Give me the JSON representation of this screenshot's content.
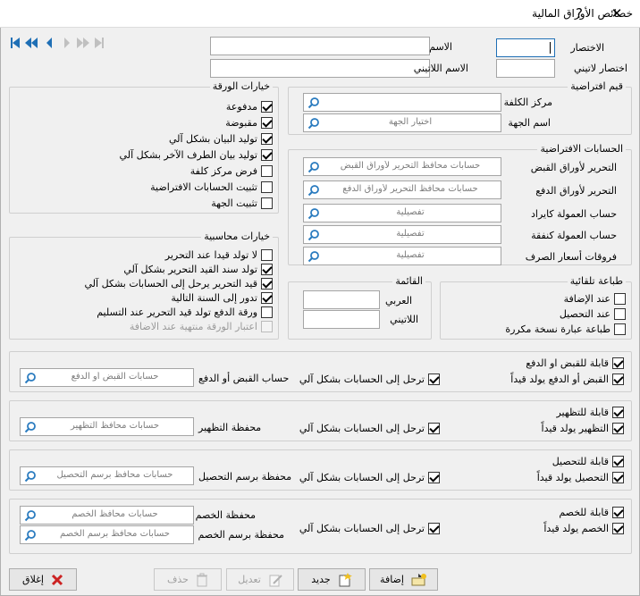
{
  "window": {
    "title": "خصائص الأوراق المالية",
    "help": "?",
    "close": "✕"
  },
  "header": {
    "abbr_label": "الاختصار",
    "abbr_value": "",
    "latin_abbr_label": "اختصار لاتيني",
    "name_label": "الاسم",
    "latin_name_label": "الاسم اللاتيني"
  },
  "paper_options": {
    "title": "خيارات الورقة",
    "items": [
      {
        "label": "مدفوعة",
        "checked": true
      },
      {
        "label": "مقبوضة",
        "checked": true
      },
      {
        "label": "توليد البيان بشكل آلي",
        "checked": true
      },
      {
        "label": "توليد بيان الطرف الآخر بشكل آلي",
        "checked": true
      },
      {
        "label": "فرض مركز كلفة",
        "checked": false
      },
      {
        "label": "تثبيت الحسابات الافتراضية",
        "checked": false
      },
      {
        "label": "تثبيت الجهة",
        "checked": false
      }
    ]
  },
  "defaults": {
    "title": "قيم افتراضية",
    "cost_center_label": "مركز الكلفة",
    "party_label": "اسم الجهة",
    "party_placeholder": "اختيار الجهة"
  },
  "default_accounts": {
    "title": "الحسابات الافتراضية",
    "rows": [
      {
        "label": "التحرير لأوراق القبض",
        "placeholder": "حسابات محافظ التحرير لأوراق القبض"
      },
      {
        "label": "التحرير لأوراق الدفع",
        "placeholder": "حسابات محافظ التحرير لأوراق الدفع"
      },
      {
        "label": "حساب العمولة كايراد",
        "placeholder": "تفصيلية"
      },
      {
        "label": "حساب العمولة كنفقة",
        "placeholder": "تفصيلية"
      },
      {
        "label": "فروقات أسعار الصرف",
        "placeholder": "تفصيلية"
      }
    ]
  },
  "accounting_options": {
    "title": "خيارات محاسبية",
    "items": [
      {
        "label": "لا تولد قيدا عند التحرير",
        "checked": false,
        "disabled": false
      },
      {
        "label": "تولد سند القيد التحرير بشكل آلي",
        "checked": true,
        "disabled": false
      },
      {
        "label": "قيد التحرير يرحل إلى الحسابات بشكل آلي",
        "checked": true,
        "disabled": false
      },
      {
        "label": "تدور إلى السنة التالية",
        "checked": true,
        "disabled": false
      },
      {
        "label": "ورقة الدفع تولد قيد التحرير عند التسليم",
        "checked": false,
        "disabled": false
      },
      {
        "label": "اعتبار الورقة منتهية عند الاضافة",
        "checked": false,
        "disabled": true
      }
    ]
  },
  "list": {
    "title": "القائمة",
    "arabic_label": "العربي",
    "latin_label": "اللاتيني"
  },
  "auto_print": {
    "title": "طباعة تلقائية",
    "items": [
      {
        "label": "عند الإضافة",
        "checked": false
      },
      {
        "label": "عند التحصيل",
        "checked": false
      },
      {
        "label": "طباعة عبارة نسخة مكررة",
        "checked": false
      }
    ]
  },
  "sections": {
    "collect_pay": {
      "cb1": {
        "label": "قابلة للقبض او الدفع",
        "checked": true
      },
      "cb2": {
        "label": "القبض أو الدفع يولد قيداً",
        "checked": true
      },
      "post": {
        "label": "ترحل إلى الحسابات بشكل آلي",
        "checked": true
      },
      "field_label": "حساب القبض أو الدفع",
      "field_placeholder": "حسابات القبض أو الدفع"
    },
    "endorse": {
      "cb1": {
        "label": "قابلة للتظهير",
        "checked": true
      },
      "cb2": {
        "label": "التظهير يولد قيداً",
        "checked": true
      },
      "post": {
        "label": "ترحل إلى الحسابات بشكل آلي",
        "checked": true
      },
      "field_label": "محفظة التظهير",
      "field_placeholder": "حسابات محافظ التظهير"
    },
    "collection": {
      "cb1": {
        "label": "قابلة للتحصيل",
        "checked": true
      },
      "cb2": {
        "label": "التحصيل يولد قيداً",
        "checked": true
      },
      "post": {
        "label": "ترحل إلى الحسابات بشكل آلي",
        "checked": true
      },
      "field_label": "محفظة برسم التحصيل",
      "field_placeholder": "حسابات محافظ برسم التحصيل"
    },
    "discount": {
      "cb1": {
        "label": "قابلة للخصم",
        "checked": true
      },
      "cb2": {
        "label": "الخصم يولد قيداً",
        "checked": true
      },
      "post": {
        "label": "ترحل إلى الحسابات بشكل آلي",
        "checked": true
      },
      "field1_label": "محفظة الخصم",
      "field1_placeholder": "حسابات محافظ الخصم",
      "field2_label": "محفظة برسم الخصم",
      "field2_placeholder": "حسابات محافظ برسم الخصم"
    }
  },
  "buttons": {
    "add": "إضافة",
    "new": "جديد",
    "edit": "تعديل",
    "delete": "حذف",
    "close": "إغلاق"
  },
  "colors": {
    "accent": "#1f6fb5",
    "magnifier": "#2a7bbf"
  }
}
